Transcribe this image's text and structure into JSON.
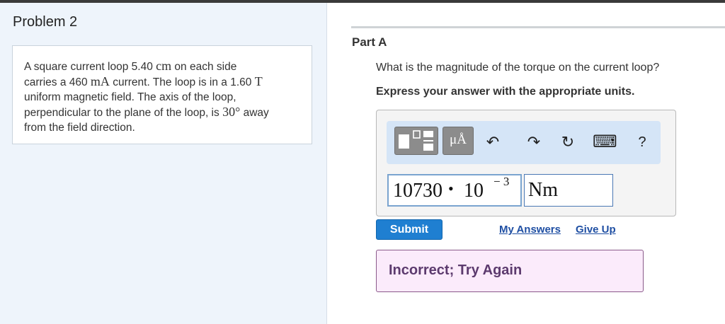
{
  "problem": {
    "title": "Problem 2",
    "text": {
      "l1_a": "A square current loop 5.40 ",
      "l1_unit": "cm",
      "l1_b": " on each side",
      "l2_a": "carries a 460 ",
      "l2_unit": "mA",
      "l2_b": " current. The loop is in a 1.60 ",
      "l2_unit2": "T",
      "l3": "uniform magnetic field. The axis of the loop,",
      "l4_a": "perpendicular to the plane of the loop, is ",
      "l4_angle": "30°",
      "l4_b": " away",
      "l5": "from the field direction."
    }
  },
  "part": {
    "label": "Part A",
    "question": "What is the magnitude of the torque on the current loop?",
    "instruction": "Express your answer with the appropriate units."
  },
  "toolbar": {
    "units_label": "μÅ",
    "undo_icon": "↶",
    "redo_icon": "↷",
    "reset_icon": "↻",
    "keyboard_icon": "⌨",
    "help_label": "?"
  },
  "answer": {
    "value_main": "10730",
    "value_dot": "•",
    "value_base": "10",
    "value_exp": "− 3",
    "units": "Nm"
  },
  "actions": {
    "submit_label": "Submit",
    "my_answers_label": "My Answers",
    "give_up_label": "Give Up"
  },
  "feedback": {
    "text": "Incorrect; Try Again"
  },
  "colors": {
    "accent": "#1f7fd1",
    "link": "#1f4fa3",
    "feedback_bg": "#fbebfb",
    "feedback_text": "#5c3a6e"
  }
}
